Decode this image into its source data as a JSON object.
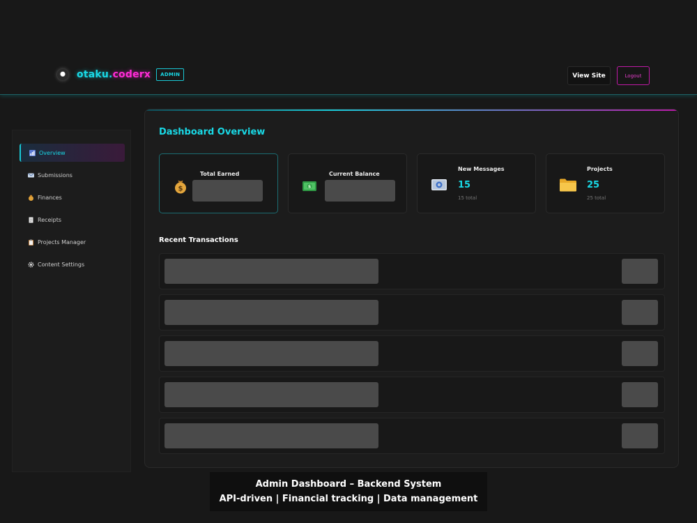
{
  "header": {
    "logo_part1": "otaku.",
    "logo_part2": "coderx",
    "badge": "ADMIN",
    "view_site_label": "View Site",
    "logout_label": "Logout"
  },
  "sidebar": {
    "items": [
      {
        "label": "Overview",
        "icon": "bar-chart-icon",
        "active": true
      },
      {
        "label": "Submissions",
        "icon": "envelope-icon",
        "active": false
      },
      {
        "label": "Finances",
        "icon": "money-bag-icon",
        "active": false
      },
      {
        "label": "Receipts",
        "icon": "receipt-icon",
        "active": false
      },
      {
        "label": "Projects Manager",
        "icon": "clipboard-icon",
        "active": false
      },
      {
        "label": "Content Settings",
        "icon": "gear-icon",
        "active": false
      }
    ]
  },
  "main": {
    "title": "Dashboard Overview",
    "stats": [
      {
        "label": "Total Earned",
        "icon": "money-bag-icon",
        "loading": true
      },
      {
        "label": "Current Balance",
        "icon": "banknote-icon",
        "loading": true
      },
      {
        "label": "New Messages",
        "icon": "envelope-icon",
        "value": "15",
        "sub": "15 total"
      },
      {
        "label": "Projects",
        "icon": "folder-icon",
        "value": "25",
        "sub": "25 total"
      }
    ],
    "transactions_title": "Recent Transactions",
    "transactions_loading_rows": 5
  },
  "caption": {
    "line1": "Admin Dashboard – Backend System",
    "line2": "API-driven | Financial tracking | Data management"
  },
  "colors": {
    "accent_cyan": "#19d9e6",
    "accent_magenta": "#ff2bd6",
    "background": "#181818"
  }
}
